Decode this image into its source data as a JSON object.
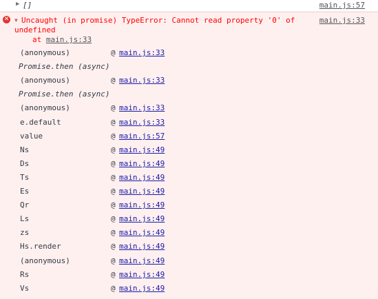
{
  "log_entry": {
    "arrow": "▶",
    "text": "[]",
    "source": "main.js:57"
  },
  "error": {
    "icon": "✕",
    "arrow": "▼",
    "message_line1": "Uncaught (in promise) TypeError: Cannot read property '0' of",
    "message_line2": "undefined",
    "at_prefix": "at ",
    "at_link": "main.js:33",
    "source": "main.js:33"
  },
  "stack": [
    {
      "type": "frame",
      "name": "(anonymous)",
      "link": "main.js:33"
    },
    {
      "type": "async",
      "name": "Promise.then (async)"
    },
    {
      "type": "frame",
      "name": "(anonymous)",
      "link": "main.js:33"
    },
    {
      "type": "async",
      "name": "Promise.then (async)"
    },
    {
      "type": "frame",
      "name": "(anonymous)",
      "link": "main.js:33"
    },
    {
      "type": "frame",
      "name": "e.default",
      "link": "main.js:33"
    },
    {
      "type": "frame",
      "name": "value",
      "link": "main.js:57"
    },
    {
      "type": "frame",
      "name": "Ns",
      "link": "main.js:49"
    },
    {
      "type": "frame",
      "name": "Ds",
      "link": "main.js:49"
    },
    {
      "type": "frame",
      "name": "Ts",
      "link": "main.js:49"
    },
    {
      "type": "frame",
      "name": "Es",
      "link": "main.js:49"
    },
    {
      "type": "frame",
      "name": "Qr",
      "link": "main.js:49"
    },
    {
      "type": "frame",
      "name": "Ls",
      "link": "main.js:49"
    },
    {
      "type": "frame",
      "name": "zs",
      "link": "main.js:49"
    },
    {
      "type": "frame",
      "name": "Hs.render",
      "link": "main.js:49"
    },
    {
      "type": "frame",
      "name": "(anonymous)",
      "link": "main.js:49"
    },
    {
      "type": "frame",
      "name": "Rs",
      "link": "main.js:49"
    },
    {
      "type": "frame",
      "name": "Vs",
      "link": "main.js:49"
    }
  ],
  "at_symbol": "@",
  "colors": {
    "error_text": "#ff0000",
    "error_background": "#fff0f0",
    "link": "#1a1aa6",
    "text": "#303942"
  }
}
